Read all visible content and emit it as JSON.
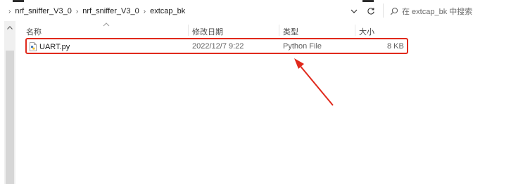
{
  "breadcrumb": {
    "items": [
      "nrf_sniffer_V3_0",
      "nrf_sniffer_V3_0",
      "extcap_bk"
    ]
  },
  "search": {
    "placeholder": "在 extcap_bk 中搜索"
  },
  "columns": {
    "name": "名称",
    "modified": "修改日期",
    "type": "类型",
    "size": "大小"
  },
  "files": [
    {
      "name": "UART.py",
      "modified": "2022/12/7 9:22",
      "type": "Python File",
      "size": "8 KB",
      "icon": "python-file-icon",
      "highlighted": true
    }
  ],
  "annotation": {
    "color": "#e0291c",
    "shape": "red-box-and-arrow"
  }
}
